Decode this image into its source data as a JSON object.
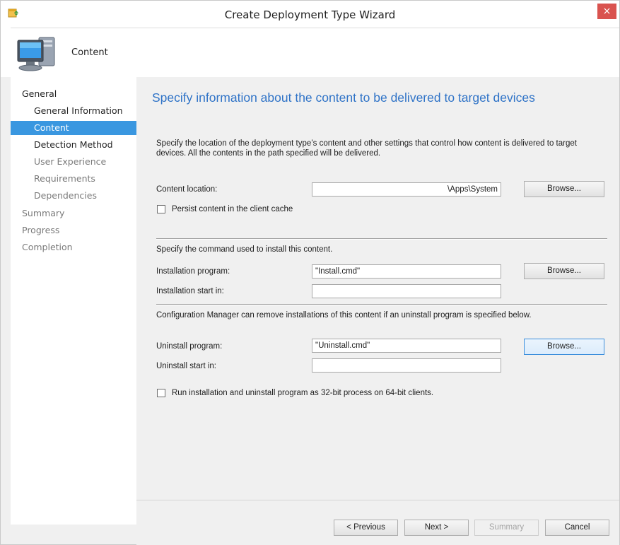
{
  "window": {
    "title": "Create Deployment Type Wizard",
    "close_glyph": "×",
    "app_icon": "wizard-app-icon",
    "accent_color": "#3a97e0",
    "heading_color": "#2f73c7"
  },
  "header": {
    "page_name": "Content",
    "icon": "computer-icon"
  },
  "sidebar": {
    "items": [
      {
        "label": "General",
        "level": 0,
        "state": "normal"
      },
      {
        "label": "General Information",
        "level": 1,
        "state": "normal"
      },
      {
        "label": "Content",
        "level": 1,
        "state": "selected"
      },
      {
        "label": "Detection Method",
        "level": 1,
        "state": "normal"
      },
      {
        "label": "User Experience",
        "level": 1,
        "state": "dim"
      },
      {
        "label": "Requirements",
        "level": 1,
        "state": "dim"
      },
      {
        "label": "Dependencies",
        "level": 1,
        "state": "dim"
      },
      {
        "label": "Summary",
        "level": 0,
        "state": "dim"
      },
      {
        "label": "Progress",
        "level": 0,
        "state": "dim"
      },
      {
        "label": "Completion",
        "level": 0,
        "state": "dim"
      }
    ]
  },
  "main": {
    "heading": "Specify information about the content to be delivered to target devices",
    "description": "Specify the location of the deployment type’s content and other settings that control how content is delivered to target devices. All the contents in the path specified will be delivered.",
    "content_location": {
      "label": "Content location:",
      "value": "\\Apps\\System",
      "browse_label": "Browse..."
    },
    "persist_cache": {
      "label": "Persist content in the client cache",
      "checked": false
    },
    "install_section_text": "Specify the command used to install this content.",
    "installation_program": {
      "label": "Installation program:",
      "value": "\"Install.cmd\"",
      "browse_label": "Browse..."
    },
    "installation_start_in": {
      "label": "Installation start in:",
      "value": ""
    },
    "uninstall_section_text": "Configuration Manager can remove installations of this content if an uninstall program is specified below.",
    "uninstall_program": {
      "label": "Uninstall program:",
      "value": "\"Uninstall.cmd\"",
      "browse_label": "Browse..."
    },
    "uninstall_start_in": {
      "label": "Uninstall start in:",
      "value": ""
    },
    "run_32bit": {
      "label": "Run installation and uninstall program as 32-bit process on 64-bit clients.",
      "checked": false
    }
  },
  "footer": {
    "previous_label": "< Previous",
    "next_label": "Next >",
    "summary_label": "Summary",
    "cancel_label": "Cancel"
  }
}
